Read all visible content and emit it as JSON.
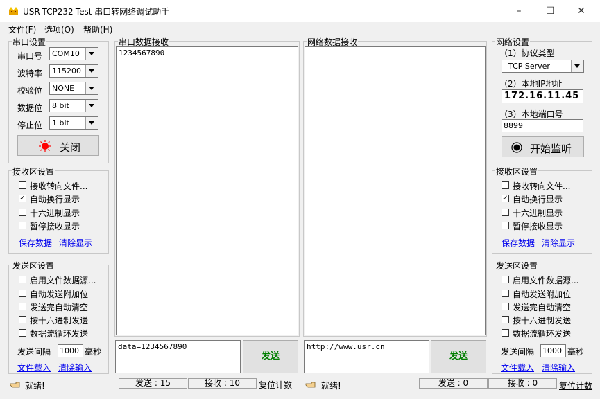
{
  "window": {
    "title": "USR-TCP232-Test 串口转网络调试助手",
    "minimize": "–",
    "maximize": "☐",
    "close": "✕"
  },
  "menu": {
    "file": "文件(F)",
    "options": "选项(O)",
    "help": "帮助(H)"
  },
  "serial_settings": {
    "title": "串口设置",
    "port_label": "串口号",
    "port_value": "COM10",
    "baud_label": "波特率",
    "baud_value": "115200",
    "parity_label": "校验位",
    "parity_value": "NONE",
    "databits_label": "数据位",
    "databits_value": "8 bit",
    "stopbits_label": "停止位",
    "stopbits_value": "1 bit",
    "close_button": "关闭",
    "close_button_color": "#ff0000"
  },
  "left_recv_settings": {
    "title": "接收区设置",
    "options": [
      {
        "label": "接收转向文件...",
        "checked": false
      },
      {
        "label": "自动换行显示",
        "checked": true
      },
      {
        "label": "十六进制显示",
        "checked": false
      },
      {
        "label": "暂停接收显示",
        "checked": false
      }
    ],
    "save_link": "保存数据",
    "clear_link": "清除显示"
  },
  "left_send_settings": {
    "title": "发送区设置",
    "options": [
      {
        "label": "启用文件数据源...",
        "checked": false
      },
      {
        "label": "自动发送附加位",
        "checked": false
      },
      {
        "label": "发送完自动清空",
        "checked": false
      },
      {
        "label": "按十六进制发送",
        "checked": false
      },
      {
        "label": "数据流循环发送",
        "checked": false
      }
    ],
    "interval_label": "发送间隔",
    "interval_value": "1000",
    "interval_unit": "毫秒",
    "load_file_link": "文件载入",
    "clear_input_link": "清除输入"
  },
  "serial_recv": {
    "title": "串口数据接收",
    "content": "1234567890"
  },
  "net_recv": {
    "title": "网络数据接收",
    "content": ""
  },
  "serial_send": {
    "content": "data=1234567890",
    "button": "发送"
  },
  "net_send": {
    "content": "http://www.usr.cn",
    "button": "发送"
  },
  "network_settings": {
    "title": "网络设置",
    "protocol_label": "（1）协议类型",
    "protocol_value": "TCP Server",
    "ip_label": "（2）本地IP地址",
    "ip_value": "172.16.11.45",
    "port_label": "（3）本地端口号",
    "port_value": "8899",
    "listen_button": "开始监听"
  },
  "right_recv_settings": {
    "title": "接收区设置",
    "options": [
      {
        "label": "接收转向文件...",
        "checked": false
      },
      {
        "label": "自动换行显示",
        "checked": true
      },
      {
        "label": "十六进制显示",
        "checked": false
      },
      {
        "label": "暂停接收显示",
        "checked": false
      }
    ],
    "save_link": "保存数据",
    "clear_link": "清除显示"
  },
  "right_send_settings": {
    "title": "发送区设置",
    "options": [
      {
        "label": "启用文件数据源...",
        "checked": false
      },
      {
        "label": "自动发送附加位",
        "checked": false
      },
      {
        "label": "发送完自动清空",
        "checked": false
      },
      {
        "label": "按十六进制发送",
        "checked": false
      },
      {
        "label": "数据流循环发送",
        "checked": false
      }
    ],
    "interval_label": "发送间隔",
    "interval_value": "1000",
    "interval_unit": "毫秒",
    "load_file_link": "文件载入",
    "clear_input_link": "清除输入"
  },
  "status": {
    "left_ready": "就绪!",
    "left_sent": "发送 : 15",
    "left_received": "接收 : 10",
    "left_reset": "复位计数",
    "right_ready": "就绪!",
    "right_sent": "发送 : 0",
    "right_received": "接收 : 0",
    "right_reset": "复位计数"
  }
}
